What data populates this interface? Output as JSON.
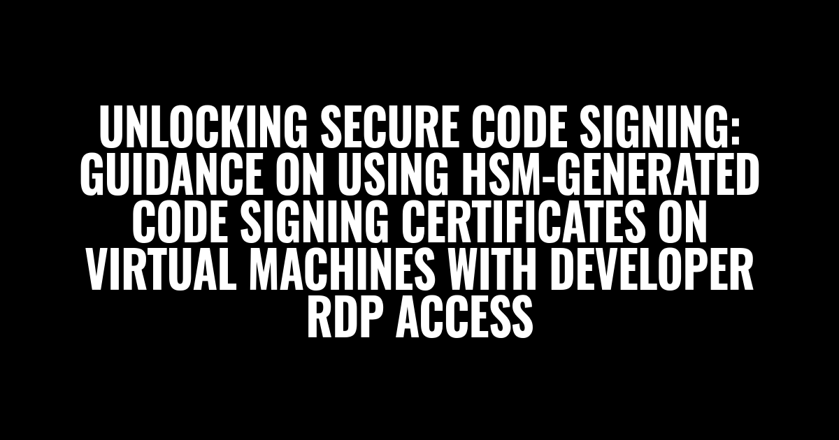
{
  "title": "Unlocking Secure Code Signing: Guidance on Using HSM-Generated Code Signing Certificates on Virtual Machines with Developer RDP Access"
}
